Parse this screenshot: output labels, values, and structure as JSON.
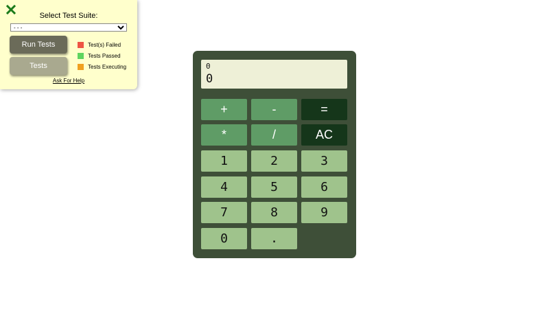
{
  "test_panel": {
    "suite_label": "Select Test Suite:",
    "suite_selected": "- - -",
    "run_button": "Run Tests",
    "tests_button": "Tests",
    "legend": [
      {
        "label": "Test(s) Failed",
        "color": "#ee5544"
      },
      {
        "label": "Tests Passed",
        "color": "#5fd45f"
      },
      {
        "label": "Tests Executing",
        "color": "#f0a020"
      }
    ],
    "help_link": "Ask For Help",
    "close_color": "#1a7a1a"
  },
  "calculator": {
    "formula": "0",
    "output": "0",
    "keys": {
      "add": "+",
      "subtract": "-",
      "equals": "=",
      "multiply": "*",
      "divide": "/",
      "clear": "AC",
      "one": "1",
      "two": "2",
      "three": "3",
      "four": "4",
      "five": "5",
      "six": "6",
      "seven": "7",
      "eight": "8",
      "nine": "9",
      "zero": "0",
      "decimal": "."
    }
  }
}
